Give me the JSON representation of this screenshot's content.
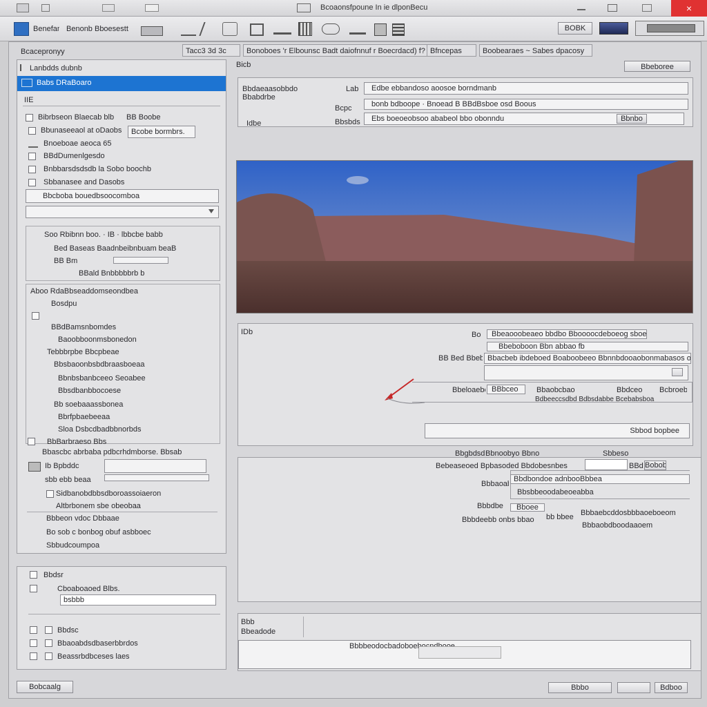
{
  "title_bar": {
    "title": "Bcoaonsfpoune In ie dlponBecu",
    "close_label": "×",
    "accent": "#e03232"
  },
  "toolbar": {
    "app_label": "Benefanp",
    "menu_label": "Benonb Bboesestt",
    "right_button": "BOBK",
    "icons": [
      "pen-icon",
      "note-icon",
      "pencil-icon",
      "stamp-icon",
      "frame-icon",
      "folder-icon",
      "grid-icon",
      "cloud-icon",
      "chart-icon",
      "ruler-icon",
      "book-icon"
    ]
  },
  "tabs_row": {
    "left_label": "Bcacepronyy",
    "tabs": [
      "Tacc3 3d 3c",
      "Bonoboes 'r Elbounsc  Badt daiofnnuf r Boecrdacd)  f?",
      "Bfncepas",
      "Boobearaes  ~  Sabes dpacosy"
    ]
  },
  "sidebar": {
    "tree_root": "Lanbdds dubnb",
    "selected_item": "Babs DRaBoaro",
    "sub_item": "IIE",
    "options": [
      {
        "label": "Bibrbseon Blaecab blb",
        "aside": "BB Boobe"
      },
      {
        "label": "Bbunaseeaol at oDaobs",
        "field": "Bcobe bormbrs."
      },
      {
        "label": "Bnoeboae aeoca 65"
      },
      {
        "label": "BBdDumenlgesdo"
      },
      {
        "label": "Bnbbarsdsdsdb la Sobo boochb"
      },
      {
        "label": "Sbbanasee and Dasobs"
      },
      {
        "label": "Bbcboba bouedbsoocomboa"
      }
    ],
    "group_header": "Soo Rbibnn boo. · IB · lbbcbe babb",
    "group_rows": [
      "Bed Baseas  Baadnbeibnbuam beaB",
      "BB Bm",
      "BBald Bnbbbbbrb b"
    ],
    "section_header": "Aboo RdaBbseaddomseondbea",
    "section_items": [
      "Bosdpu",
      "BBdBamsnbomdes",
      "Baoobboonmsbonedon",
      "Tebbbrpbe Bbcpbeae",
      "Bbsbaoonbsbdbraasboeaa",
      "Bbnbsbanbceeo Seoabee",
      "Bbsdbanbbocoese",
      "Bb soebaaassbonea",
      "Bbrfpbaebeeaa",
      "Sloa Dsbcdbadbbnorbds",
      "BbBarbraeso Bbs"
    ],
    "extra": [
      {
        "label": "Bbascbc abrbaba pdbcrhdmborse. Bbsab"
      },
      {
        "label": "Ib Bpbddc",
        "sub": "sbb ebb beaa"
      },
      {
        "label": "Sidbanobdbbsdboroassoiaeron"
      },
      {
        "label": "Altbrbonem sbe obeobaa"
      },
      {
        "label": "Bbbeon vdoc Dbbaae"
      },
      {
        "label": "Bo sob c bonbog obuf asbboec"
      },
      {
        "label": "Sbbudcoumpoa"
      }
    ],
    "bottom_group": {
      "item1": "Bbdsr",
      "item2": "Cboaboaoed Blbs.",
      "field_value": "bsbbb"
    },
    "checks": [
      "Bbdsc",
      "Bbaoabdsdbaserbbrdos",
      "Beassrbdbceses laes"
    ],
    "status_button": "Bobcaalg"
  },
  "main": {
    "header_label": "Bicb",
    "header_button": "Bbeboree",
    "form": {
      "left_label": "Bbdaeaasobbdo",
      "left_label2": "Bbabdrbe",
      "left_label3": "Idbe",
      "r1_label": "Lab",
      "r1_value": "Edbe ebbandoso aoosoe borndmanb",
      "r2_label": "Bcpc",
      "r2_value": "bonb bdboope · Bnoead B  BBdBsboe osd Boous",
      "r3_label": "Bbsbds",
      "r3_value": "Ebs boeoeobsoo ababeol bbo obonndu",
      "r3_button": "Bbnbo"
    },
    "details": {
      "label": "IDb",
      "r1_label": "Bo",
      "r1_value": "Bbeaooobeaeo bbdbo  Bboooocdeboeog sboe)",
      "r2_value": "Bbeboboon Bbn abbao  fb",
      "r3_label": "BB Bed Bbebs",
      "r3_value": "Bbacbeb ibdeboed Boaboobeeo Bbnnbdooaobonmabasos ombeg",
      "r4_label": "Bbeloaebe",
      "r4_value": "BBbceo",
      "r4_mid": "Bbaobcbao",
      "r4_extra": "Bbdceo",
      "r5_value": "Bdbeeccsdbd  Bdbsdabbe  Bcebabsboa",
      "r5_right": "Bcbroeb",
      "bottom_field": "Sbbod bopbee"
    },
    "lower": {
      "top_labels": [
        "Bbgbdsd",
        "Bbnoobyo Bbno",
        "Sbbeso"
      ],
      "row1_label": "Bebeaseoed Bpbasoded Bbdobesnbes",
      "row1_right": "BBd",
      "row1_button": "Bobob",
      "row2_label": "Bbbaoabs",
      "row2_value": "Bbdbondoe adnbooBbbea",
      "row3_value": "Bbsbbeoodabeoeabba",
      "row4_label": "Bbbdbe",
      "row4_value": "Bboee",
      "row4_mid": "bb  bbeee",
      "row4_right": "Bbbaebcddosbbbaoeboeom",
      "row5_label": "Bbbdeebb onbs bbao",
      "row5_right": "Bbbaobdboodaaoem"
    },
    "footer_panel": {
      "label1": "Bbb",
      "label2": "Bbeadode",
      "value": "Bbbbeodocbadoboebocndbooe"
    }
  },
  "bottom_buttons": [
    "Bbbo",
    "",
    "Bdboo"
  ]
}
